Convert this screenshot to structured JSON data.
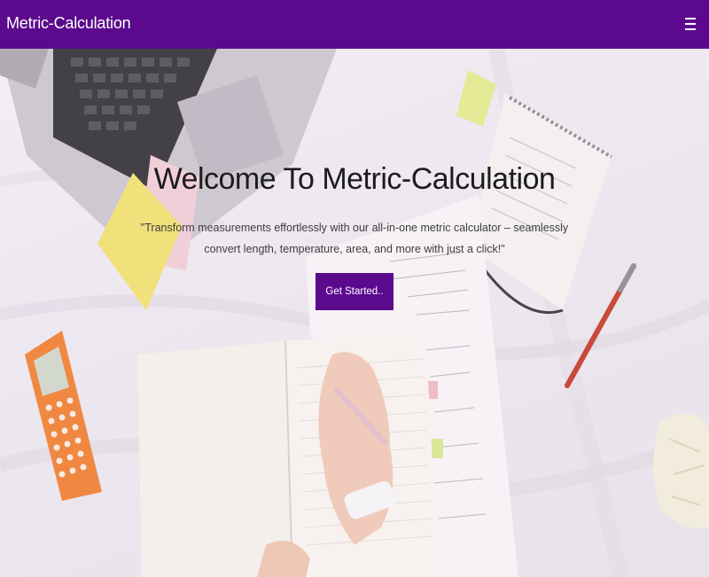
{
  "navbar": {
    "brand": "Metric-Calculation",
    "menu_icon": "hamburger-menu-icon"
  },
  "hero": {
    "title": "Welcome To Metric-Calculation",
    "description": "\"Transform measurements effortlessly with our all-in-one metric calculator – seamlessly convert length, temperature, area, and more with just a click!\"",
    "cta_label": "Get Started.."
  },
  "colors": {
    "primary": "#5b0a8e",
    "nav_text": "#ffffff",
    "title_text": "#1c1c1c"
  }
}
